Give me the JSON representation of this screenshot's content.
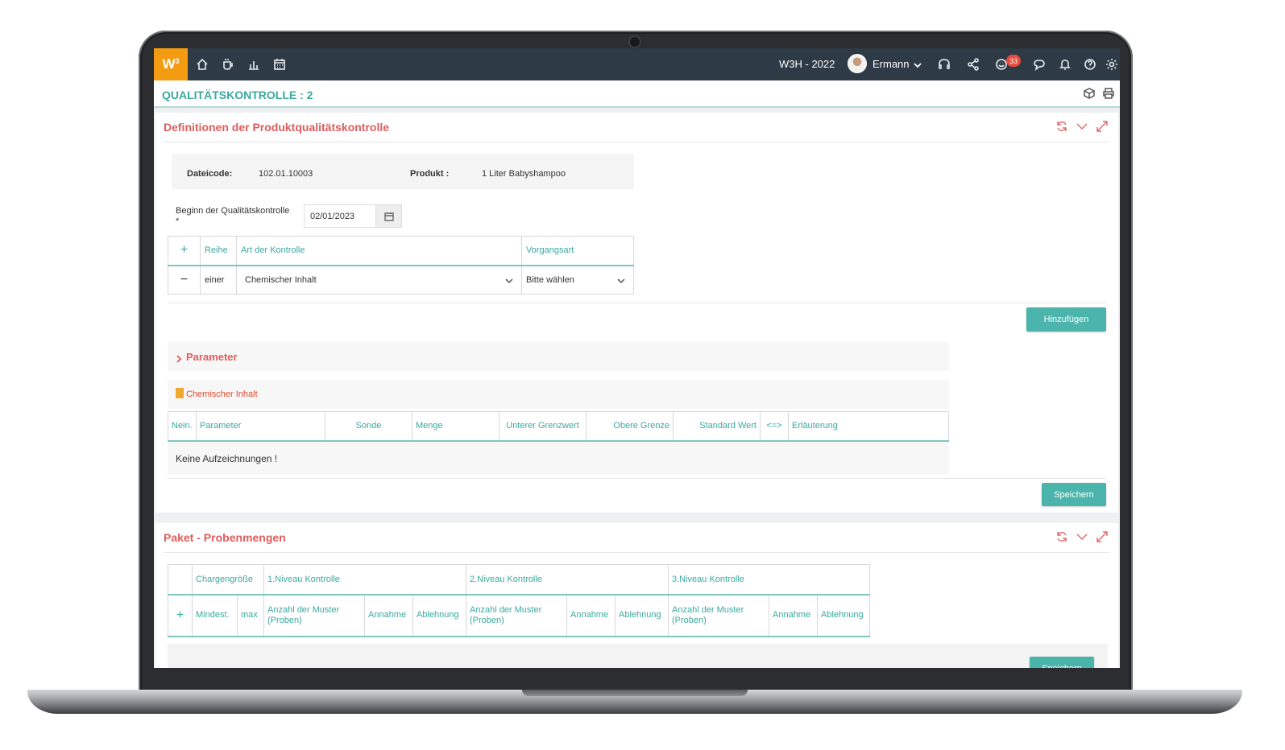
{
  "topbar": {
    "logo": "W",
    "logo_sup": "3",
    "year": "W3H - 2022",
    "user": "Ermann",
    "notif_count": "33",
    "nav_icons": [
      "home-icon",
      "coffee-icon",
      "chart-icon",
      "calendar-icon"
    ],
    "right_icons": [
      "headset-icon",
      "share-icon",
      "smiley-icon",
      "chat-icon",
      "bell-icon",
      "help-icon",
      "gear-icon"
    ]
  },
  "page": {
    "title": "QUALITÄTSKONTROLLE : 2"
  },
  "panel1": {
    "title": "Definitionen der Produktqualitätskontrolle",
    "info": {
      "code_label": "Dateicode:",
      "code_value": "102.01.10003",
      "product_label": "Produkt :",
      "product_value": "1 Liter Babyshampoo"
    },
    "date_label": "Beginn der Qualitätskontrolle",
    "date_required": "*",
    "date_value": "02/01/2023",
    "control_table": {
      "add": "+",
      "remove": "−",
      "headers": [
        "Reihe",
        "Art der Kontrolle",
        "Vorgangsart"
      ],
      "row": {
        "reihe": "einer",
        "art": "Chemischer Inhalt",
        "vorgang": "Bitte wählen"
      }
    },
    "add_button": "Hinzufügen",
    "parameter_label": "Parameter",
    "chem_label": "Chemischer Inhalt",
    "param_headers": [
      "Nein.",
      "Parameter",
      "Sonde",
      "Menge",
      "Unterer Grenzwert",
      "Obere Grenze",
      "Standard Wert",
      "<=>",
      "Erläuterung"
    ],
    "no_records": "Keine Aufzeichnungen !",
    "save_button": "Speichern"
  },
  "panel2": {
    "title": "Paket - Probenmengen",
    "header_row1": [
      "",
      "Chargengröße",
      "1.Niveau Kontrolle",
      "2.Niveau Kontrolle",
      "3.Niveau Kontrolle"
    ],
    "header_row2": [
      "+",
      "Mindest.",
      "max",
      "Anzahl der Muster (Proben)",
      "Annahme",
      "Ablehnung",
      "Anzahl der Muster (Proben)",
      "Annahme",
      "Ablehnung",
      "Anzahl der Muster (Proben)",
      "Annahme",
      "Ablehnung"
    ],
    "save_button": "Speichern"
  },
  "colors": {
    "accent": "#3aa9a0",
    "brand": "#f39c12",
    "panel_title": "#e05c5c",
    "topbar": "#2e3a45"
  }
}
